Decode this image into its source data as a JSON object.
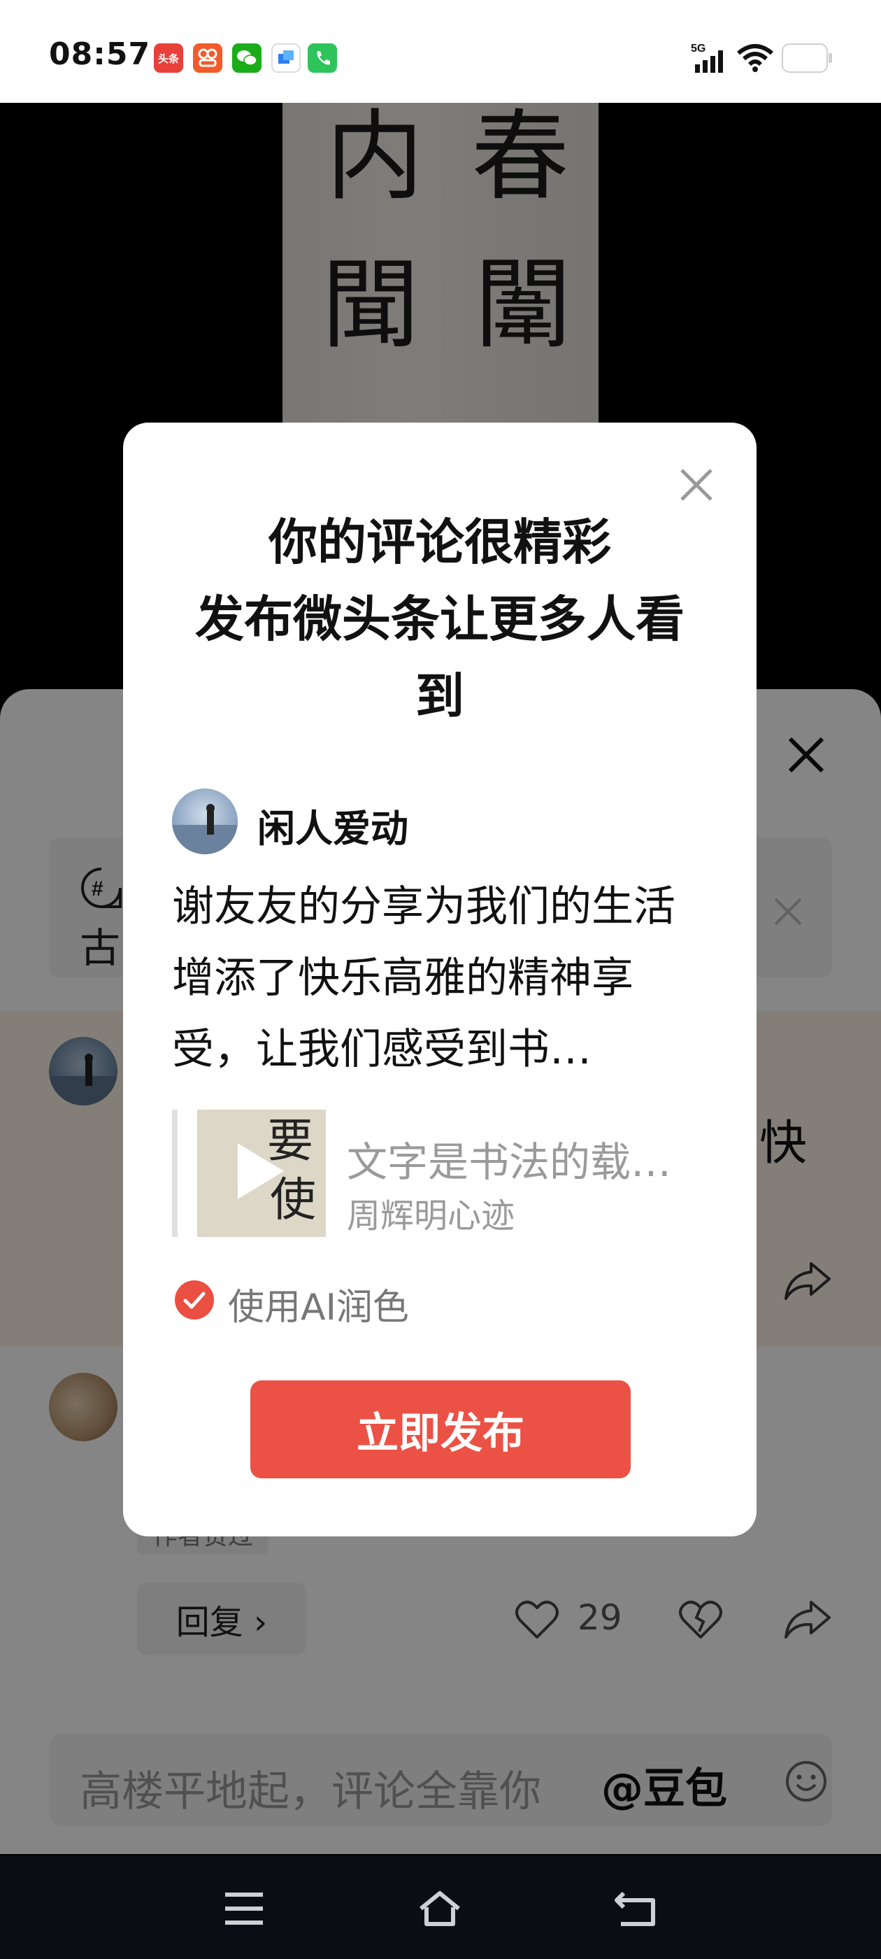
{
  "status_bar": {
    "time": "08:57",
    "app_icons": [
      {
        "name": "toutiao-icon",
        "label": "头条",
        "color": "#e8413a"
      },
      {
        "name": "dianping-icon",
        "label": "",
        "color": "#f25b2a"
      },
      {
        "name": "wechat-icon",
        "label": "",
        "color": "#1aad19"
      },
      {
        "name": "app-icon",
        "label": "",
        "color": "#3a7cf0"
      },
      {
        "name": "phone-app-icon",
        "label": "",
        "color": "#2fc35b"
      }
    ],
    "network": "5G"
  },
  "video": {
    "calligraphy_left": [
      "内",
      "聞"
    ],
    "calligraphy_right": [
      "春",
      "闈"
    ]
  },
  "sheet": {
    "topic_icon": "#",
    "topic_text": "古",
    "highlight_text": "快",
    "author_tag": "作者赞过",
    "reply_label": "回复 ›",
    "like_count": "29",
    "input_placeholder": "高楼平地起，评论全靠你",
    "mention": "@豆包"
  },
  "modal": {
    "title": "你的评论很精彩\n发布微头条让更多人看\n到",
    "username": "闲人爱动",
    "comment": "谢友友的分享为我们的生活增添了快乐高雅的精神享受，让我们感受到书…",
    "quote_title": "文字是书法的载…",
    "quote_author": "周辉明心迹",
    "thumb_chars": [
      "要",
      "使"
    ],
    "ai_polish_label": "使用AI润色",
    "ai_polish_checked": true,
    "publish_label": "立即发布"
  },
  "colors": {
    "accent": "#ec5145",
    "highlight_bg": "#fbf4e6",
    "overlay": "rgba(0,0,0,0.48)"
  }
}
